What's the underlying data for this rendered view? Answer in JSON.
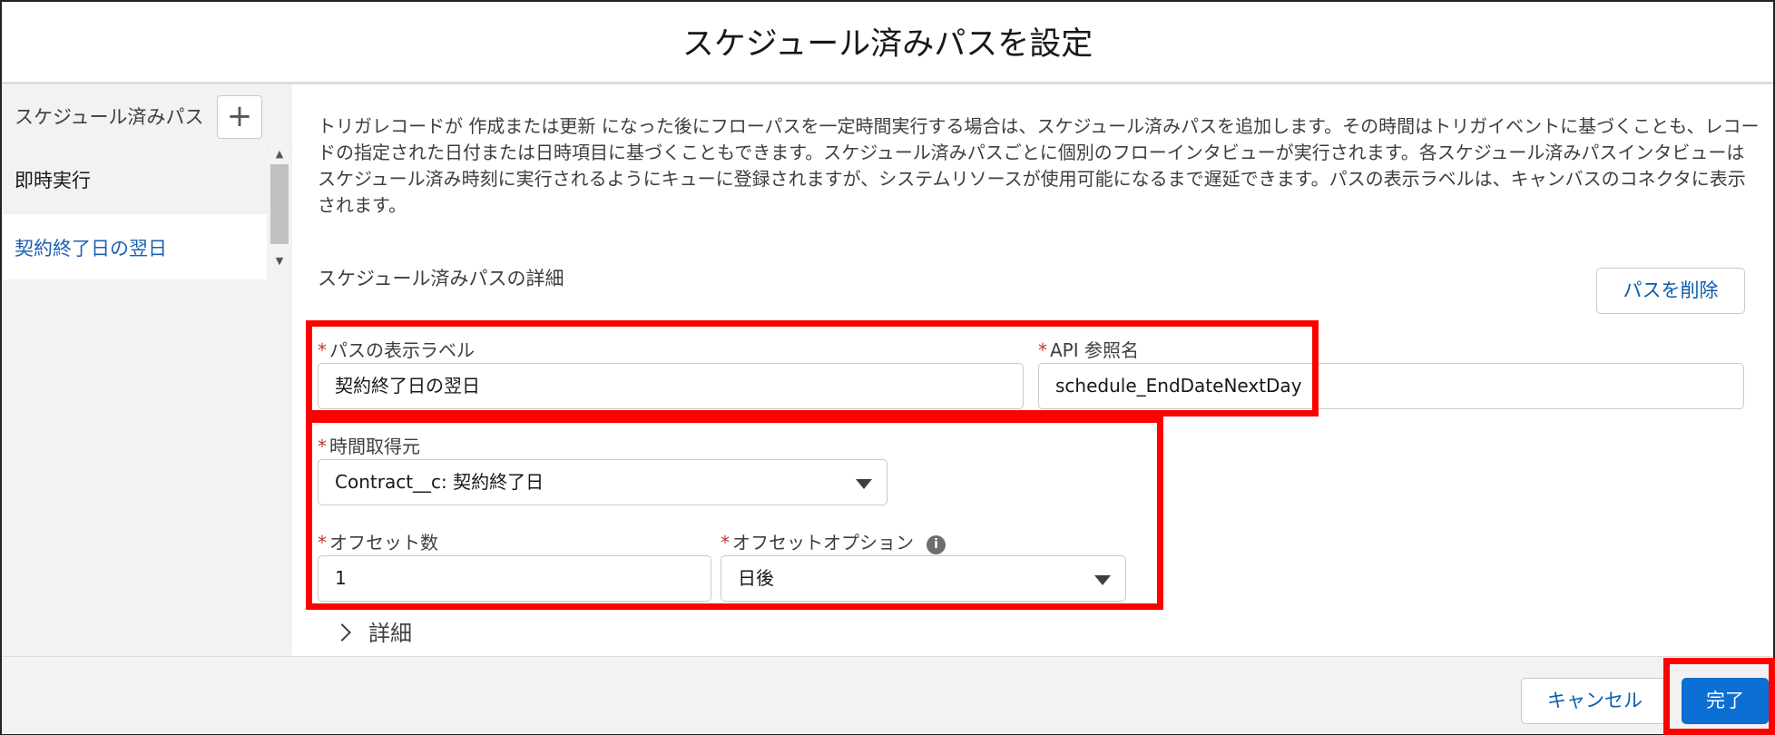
{
  "dialog": {
    "title": "スケジュール済みパスを設定"
  },
  "sidebar": {
    "title": "スケジュール済みパス",
    "add_label": "+",
    "items": [
      {
        "label": "即時実行"
      },
      {
        "label": "契約終了日の翌日"
      }
    ]
  },
  "content": {
    "description": "トリガレコードが 作成または更新 になった後にフローパスを一定時間実行する場合は、スケジュール済みパスを追加します。その時間はトリガイベントに基づくことも、レコードの指定された日付または日時項目に基づくこともできます。スケジュール済みパスごとに個別のフローインタビューが実行されます。各スケジュール済みパスインタビューはスケジュール済み時刻に実行されるようにキューに登録されますが、システムリソースが使用可能になるまで遅延できます。パスの表示ラベルは、キャンバスのコネクタに表示されます。",
    "section_title": "スケジュール済みパスの詳細",
    "delete_button": "パスを削除",
    "required_mark": "*",
    "fields": {
      "label": {
        "label": "パスの表示ラベル",
        "value": "契約終了日の翌日"
      },
      "api_name": {
        "label": "API 参照名",
        "value": "schedule_EndDateNextDay"
      },
      "time_source": {
        "label": "時間取得元",
        "value": "Contract__c: 契約終了日"
      },
      "offset_number": {
        "label": "オフセット数",
        "value": "1"
      },
      "offset_option": {
        "label": "オフセットオプション",
        "value": "日後"
      }
    },
    "details_toggle": "詳細",
    "info_glyph": "i"
  },
  "footer": {
    "cancel": "キャンセル",
    "done": "完了"
  },
  "colors": {
    "highlight": "#ff0000",
    "primary": "#0b6fd3",
    "link": "#0b5cab",
    "required": "#c23934"
  }
}
